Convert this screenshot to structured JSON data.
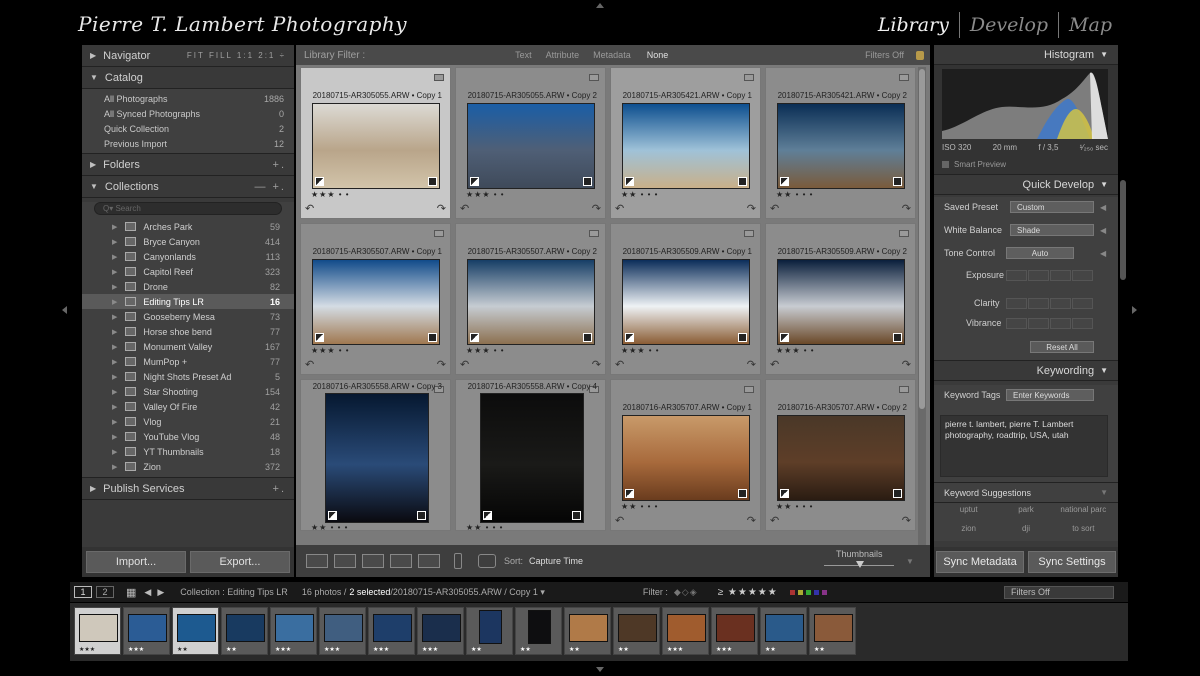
{
  "app": {
    "brand": "Pierre T. Lambert Photography",
    "modules": [
      "Library",
      "Develop",
      "Map"
    ]
  },
  "left_panel": {
    "navigator": {
      "title": "Navigator",
      "zoom_options": "FIT  FILL  1:1  2:1 ÷"
    },
    "catalog": {
      "title": "Catalog",
      "items": [
        {
          "label": "All Photographs",
          "count": "1886"
        },
        {
          "label": "All Synced Photographs",
          "count": "0"
        },
        {
          "label": "Quick Collection",
          "count": "2"
        },
        {
          "label": "Previous Import",
          "count": "12"
        }
      ]
    },
    "folders": {
      "title": "Folders",
      "action": "+."
    },
    "collections": {
      "title": "Collections",
      "actions": "— +.",
      "search_placeholder": "Q▾ Search",
      "items": [
        {
          "label": "Arches Park",
          "count": "59"
        },
        {
          "label": "Bryce Canyon",
          "count": "414"
        },
        {
          "label": "Canyonlands",
          "count": "113"
        },
        {
          "label": "Capitol Reef",
          "count": "323"
        },
        {
          "label": "Drone",
          "count": "82"
        },
        {
          "label": "Editing Tips LR",
          "count": "16"
        },
        {
          "label": "Gooseberry Mesa",
          "count": "73"
        },
        {
          "label": "Horse shoe bend",
          "count": "77"
        },
        {
          "label": "Monument Valley",
          "count": "167"
        },
        {
          "label": "MumPop  +",
          "count": "77"
        },
        {
          "label": "Night Shots Preset Ad",
          "count": "5"
        },
        {
          "label": "Star Shooting",
          "count": "154"
        },
        {
          "label": "Valley Of Fire",
          "count": "42"
        },
        {
          "label": "Vlog",
          "count": "21"
        },
        {
          "label": "YouTube Vlog",
          "count": "48"
        },
        {
          "label": "YT Thumbnails",
          "count": "18"
        },
        {
          "label": "Zion",
          "count": "372"
        }
      ],
      "selected_index": 5
    },
    "publish": {
      "title": "Publish Services",
      "action": "+."
    },
    "import_label": "Import...",
    "export_label": "Export..."
  },
  "filter_bar": {
    "title": "Library Filter :",
    "tabs": [
      "Text",
      "Attribute",
      "Metadata",
      "None"
    ],
    "status": "Filters Off"
  },
  "grid": {
    "cells": [
      {
        "file": "20180715-AR305055.ARW • Copy 1",
        "stars": "★★★ • •",
        "state": "sel",
        "colors": [
          "#dcdad4",
          "#b9a58a",
          "#d2c4aa"
        ],
        "portrait": false
      },
      {
        "file": "20180715-AR305055.ARW • Copy 2",
        "stars": "★★★ • •",
        "state": "",
        "colors": [
          "#1a5ea6",
          "#4f5f76",
          "#3f4a5a"
        ],
        "portrait": false
      },
      {
        "file": "20180715-AR305421.ARW • Copy 1",
        "stars": "★★ • • •",
        "state": "sel2",
        "colors": [
          "#0d4f8f",
          "#9fc2d8",
          "#c9b089"
        ],
        "portrait": false
      },
      {
        "file": "20180715-AR305421.ARW • Copy 2",
        "stars": "★★ • • •",
        "state": "",
        "colors": [
          "#0a2e55",
          "#5f7f98",
          "#7a5b3b"
        ],
        "portrait": false
      },
      {
        "file": "20180715-AR305507.ARW • Copy 1",
        "stars": "★★★ • •",
        "state": "",
        "colors": [
          "#114b8a",
          "#d4dce4",
          "#a07850"
        ],
        "portrait": false
      },
      {
        "file": "20180715-AR305507.ARW • Copy 2",
        "stars": "★★★ • •",
        "state": "",
        "colors": [
          "#163e66",
          "#c6ccd2",
          "#8c7050"
        ],
        "portrait": false
      },
      {
        "file": "20180715-AR305509.ARW • Copy 1",
        "stars": "★★★ • •",
        "state": "",
        "colors": [
          "#0b2d5a",
          "#eef2f5",
          "#8a5c34"
        ],
        "portrait": false
      },
      {
        "file": "20180715-AR305509.ARW • Copy 2",
        "stars": "★★★ • •",
        "state": "",
        "colors": [
          "#0a1f3c",
          "#c8ccd2",
          "#6a4828"
        ],
        "portrait": false
      },
      {
        "file": "20180716-AR305558.ARW • Copy 3",
        "stars": "★★ • • •",
        "state": "",
        "colors": [
          "#061830",
          "#2a4b78",
          "#0a0a10"
        ],
        "portrait": true
      },
      {
        "file": "20180716-AR305558.ARW • Copy 4",
        "stars": "★★ • • •",
        "state": "",
        "colors": [
          "#0c0c0c",
          "#1a1a18",
          "#050505"
        ],
        "portrait": true
      },
      {
        "file": "20180716-AR305707.ARW • Copy 1",
        "stars": "★★ • • •",
        "state": "",
        "colors": [
          "#c89a6a",
          "#a86a3c",
          "#6a3c1e"
        ],
        "portrait": false
      },
      {
        "file": "20180716-AR305707.ARW • Copy 2",
        "stars": "★★ • • •",
        "state": "",
        "colors": [
          "#4a3828",
          "#5e3e28",
          "#2a1c12"
        ],
        "portrait": false
      }
    ]
  },
  "toolbar": {
    "sort_label": "Sort:",
    "sort_value": "Capture Time",
    "thumbnails_label": "Thumbnails"
  },
  "right_panel": {
    "histogram_title": "Histogram",
    "exif": {
      "iso": "ISO 320",
      "focal": "20 mm",
      "aperture": "f / 3,5",
      "shutter": "¹⁄₂₅₀ sec"
    },
    "smart_preview": "Smart Preview",
    "quick_develop": {
      "title": "Quick Develop",
      "saved_preset_label": "Saved Preset",
      "saved_preset_value": "Custom",
      "wb_label": "White Balance",
      "wb_value": "Shade",
      "tone_label": "Tone Control",
      "auto_label": "Auto",
      "exposure": "Exposure",
      "clarity": "Clarity",
      "vibrance": "Vibrance",
      "reset": "Reset All"
    },
    "keywording": {
      "title": "Keywording",
      "tags_label": "Keyword Tags",
      "tags_value": "Enter Keywords",
      "keywords": "pierre t. lambert, pierre T. Lambert photography, roadtrip, USA, utah",
      "suggestions_title": "Keyword Suggestions",
      "suggestions": [
        "uptut",
        "park",
        "national parc",
        "zion",
        "dji",
        "to sort"
      ]
    },
    "sync_metadata": "Sync Metadata",
    "sync_settings": "Sync Settings"
  },
  "filmstrip_bar": {
    "page1": "1",
    "page2": "2",
    "source": "Collection : Editing Tips LR",
    "count_prefix": "16 photos /",
    "count_sel": "2 selected",
    "count_file": "/20180715-AR305055.ARW / Copy 1 ▾",
    "filter_label": "Filter :",
    "rating": "≥ ★★★★★",
    "filter_status": "Filters Off"
  },
  "filmstrip": [
    {
      "c": "#cfc8bb",
      "s": "★★★",
      "sel": true
    },
    {
      "c": "#2b5c95",
      "s": "★★★",
      "sel": false
    },
    {
      "c": "#1d5a90",
      "s": "★★",
      "sel": true
    },
    {
      "c": "#183a60",
      "s": "★★",
      "sel": false
    },
    {
      "c": "#3a6ea0",
      "s": "★★★",
      "sel": false
    },
    {
      "c": "#405e80",
      "s": "★★★",
      "sel": false
    },
    {
      "c": "#1e3e6a",
      "s": "★★★",
      "sel": false
    },
    {
      "c": "#1a2e4c",
      "s": "★★★",
      "sel": false
    },
    {
      "c": "#1c3660",
      "s": "★★",
      "sel": false
    },
    {
      "c": "#0e0e10",
      "s": "★★",
      "sel": false
    },
    {
      "c": "#b07a48",
      "s": "★★",
      "sel": false
    },
    {
      "c": "#4e3826",
      "s": "★★",
      "sel": false
    },
    {
      "c": "#a05c2e",
      "s": "★★★",
      "sel": false
    },
    {
      "c": "#6a3020",
      "s": "★★★",
      "sel": false
    },
    {
      "c": "#2a5a8a",
      "s": "★★",
      "sel": false
    },
    {
      "c": "#8a5a3a",
      "s": "★★",
      "sel": false
    }
  ]
}
